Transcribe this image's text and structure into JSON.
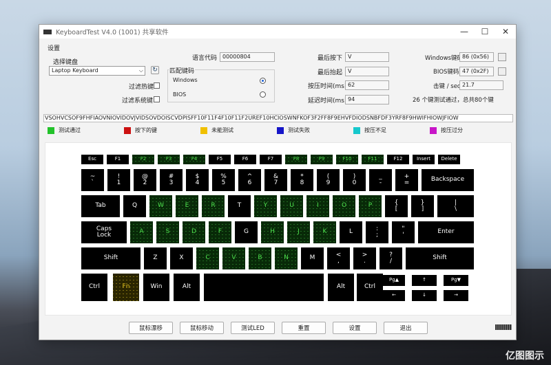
{
  "window": {
    "title": "KeyboardTest V4.0 (1001) 共享软件",
    "controls": [
      "—",
      "☐",
      "✕"
    ]
  },
  "settings": {
    "group_label": "设置",
    "select_keyboard_label": "选择键盘",
    "keyboard_value": "Laptop Keyboard",
    "filter_hotkeys_label": "过滤热键",
    "filter_system_keys_label": "过滤系统键",
    "match_code_label": "匹配键码",
    "match_options": [
      "Windows",
      "BIOS"
    ],
    "match_selected": "Windows",
    "lang_code_label": "语言代码",
    "lang_code_value": "00000804"
  },
  "stats": {
    "last_pressed_label": "最后按下",
    "last_pressed_value": "V",
    "last_released_label": "最后抬起",
    "last_released_value": "V",
    "press_time_label": "按压时间(ms)",
    "press_time_value": "62",
    "latency_label": "延迟时间(ms)",
    "latency_value": "94",
    "windows_code_label": "Windows键码",
    "windows_code_value": "86 (0x56)",
    "bios_code_label": "BIOS键码",
    "bios_code_value": "47 (0x2F)",
    "rate_label": "击键 / sec",
    "rate_value": "21.7",
    "summary": "26 个键测试通过，总共80个键"
  },
  "ticker": "VSOHVCSOF9FHFIAOVNIOVIDOVJVIDSOVDOISCVDPISFF10F11F4F10F11F2UREF10HCIOSWNFKOF3F2FF8F9EHVFDIODSNBFDF3YRF8F9HWIFHIOWJFIOW",
  "legend": [
    {
      "label": "测试通过",
      "color": "#22c22a"
    },
    {
      "label": "按下的键",
      "color": "#cc1111"
    },
    {
      "label": "未能测试",
      "color": "#f0c000"
    },
    {
      "label": "测试失败",
      "color": "#1515c8"
    },
    {
      "label": "按压不足",
      "color": "#16c8cc"
    },
    {
      "label": "按压过分",
      "color": "#c816c8"
    }
  ],
  "keys": {
    "esc": "Esc",
    "f1": "F1",
    "f2": "F2",
    "f3": "F3",
    "f4": "F4",
    "f5": "F5",
    "f6": "F6",
    "f7": "F7",
    "f8": "F8",
    "f9": "F9",
    "f10": "F10",
    "f11": "F11",
    "f12": "F12",
    "insert": "Insert",
    "delete": "Delete",
    "tilde": [
      "~",
      "`"
    ],
    "n1": [
      "!",
      "1"
    ],
    "n2": [
      "@",
      "2"
    ],
    "n3": [
      "#",
      "3"
    ],
    "n4": [
      "$",
      "4"
    ],
    "n5": [
      "%",
      "5"
    ],
    "n6": [
      "^",
      "6"
    ],
    "n7": [
      "&",
      "7"
    ],
    "n8": [
      "*",
      "8"
    ],
    "n9": [
      "(",
      "9"
    ],
    "n0": [
      ")",
      "0"
    ],
    "minus": [
      "_",
      "-"
    ],
    "equal": [
      "+",
      "="
    ],
    "backspace": "Backspace",
    "tab": "Tab",
    "q": "Q",
    "w": "W",
    "e": "E",
    "r": "R",
    "t": "T",
    "y": "Y",
    "u": "U",
    "i": "I",
    "o": "O",
    "p": "P",
    "lbracket": [
      "{",
      "["
    ],
    "rbracket": [
      "}",
      "]"
    ],
    "backslash": [
      "|",
      "\\"
    ],
    "caps": [
      "Caps",
      "Lock"
    ],
    "a": "A",
    "s": "S",
    "d": "D",
    "f": "F",
    "g": "G",
    "h": "H",
    "j": "J",
    "k": "K",
    "l": "L",
    "semicolon": [
      ":",
      ";"
    ],
    "quote": [
      "\"",
      "'"
    ],
    "enter": "Enter",
    "lshift": "Shift",
    "z": "Z",
    "x": "X",
    "c": "C",
    "v": "V",
    "b": "B",
    "n": "N",
    "m": "M",
    "comma": [
      "<",
      ","
    ],
    "period": [
      ">",
      "."
    ],
    "slash": [
      "?",
      "/"
    ],
    "rshift": "Shift",
    "lctrl": "Ctrl",
    "fn": "Fn",
    "win": "Win",
    "lalt": "Alt",
    "space": "",
    "ralt": "Alt",
    "rctrl": "Ctrl",
    "pgup": "Pg▲",
    "up": "↑",
    "pgdn": "Pg▼",
    "left": "←",
    "down": "↓",
    "right": "→"
  },
  "buttons": [
    "鼠标漂移",
    "鼠标移动",
    "测试LED",
    "重置",
    "设置",
    "退出"
  ],
  "watermark": "亿图图示"
}
